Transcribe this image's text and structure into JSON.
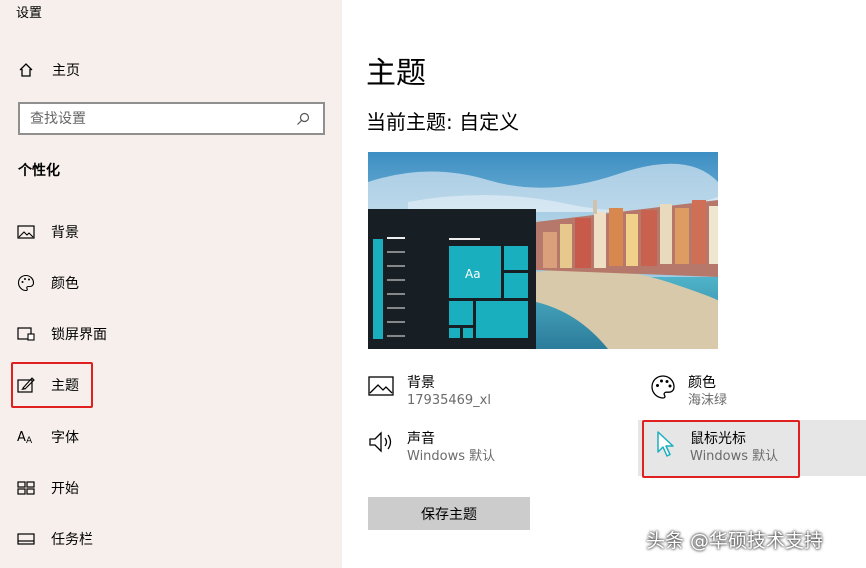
{
  "window": {
    "title": "设置"
  },
  "sidebar": {
    "home_label": "主页",
    "search_placeholder": "查找设置",
    "section": "个性化",
    "items": [
      {
        "label": "背景",
        "icon": "image-icon"
      },
      {
        "label": "颜色",
        "icon": "palette-icon"
      },
      {
        "label": "锁屏界面",
        "icon": "lock-screen-icon"
      },
      {
        "label": "主题",
        "icon": "theme-icon",
        "selected": true
      },
      {
        "label": "字体",
        "icon": "font-icon"
      },
      {
        "label": "开始",
        "icon": "start-icon"
      },
      {
        "label": "任务栏",
        "icon": "taskbar-icon"
      }
    ]
  },
  "main": {
    "title": "主题",
    "current_theme": "当前主题: 自定义",
    "preview_tile_text": "Aa",
    "properties": {
      "background": {
        "name": "背景",
        "value": "17935469_xl"
      },
      "color": {
        "name": "颜色",
        "value": "海沫绿"
      },
      "sound": {
        "name": "声音",
        "value": "Windows 默认"
      },
      "cursor": {
        "name": "鼠标光标",
        "value": "Windows 默认"
      }
    },
    "save_button": "保存主题"
  },
  "watermark": "头条 @华硕技术支持",
  "colors": {
    "accent": "#1aafbf",
    "highlight": "#e02020",
    "sidebar_bg": "#f6efec"
  }
}
